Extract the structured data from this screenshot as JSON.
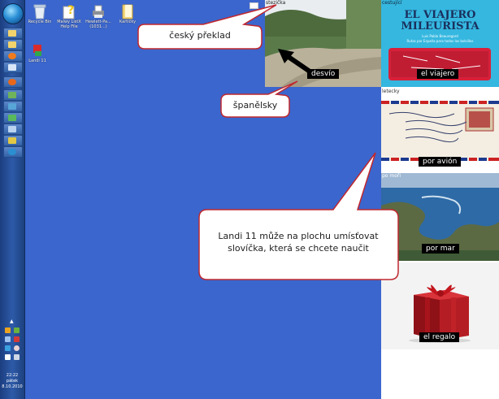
{
  "taskbar": {
    "buttons": [
      "folder",
      "folder",
      "firefox",
      "window",
      "window",
      "window",
      "window",
      "window",
      "window",
      "window",
      "globe"
    ],
    "clock": {
      "time": "22:22",
      "day": "pátek",
      "date": "8.10.2010"
    }
  },
  "desktop_icons": [
    {
      "label": "Recycle Bin",
      "icon": "recycle-bin-icon"
    },
    {
      "label": "Malwy ListX Help File",
      "icon": "help-file-icon"
    },
    {
      "label": "Hewlett-Pa... (1031...)",
      "icon": "printer-icon"
    },
    {
      "label": "Kartičky",
      "icon": "folder-icon"
    },
    {
      "label": "Landi 11",
      "icon": "landi-app-icon"
    }
  ],
  "cards": [
    {
      "category": "stezička",
      "word": "desvío"
    },
    {
      "category": "cestující",
      "word": "el viajero"
    },
    {
      "category": "letecky",
      "word": "por avión"
    },
    {
      "category": "po moři",
      "word": "por mar"
    },
    {
      "category": "",
      "word": "el regalo"
    }
  ],
  "book": {
    "title_line1": "EL VIAJERO",
    "title_line2": "MILEURISTA",
    "author": "Luis Pablo Beauregard",
    "subtitle": "Rutas por España para todos los bolsillos"
  },
  "callouts": {
    "czech": "český překlad",
    "spanish": "španělsky",
    "info": "Landi 11 může na plochu umísťovat slovíčka, která se chcete naučit"
  },
  "colors": {
    "desktop": "#3b66cd",
    "callout_border": "#c0282f"
  }
}
